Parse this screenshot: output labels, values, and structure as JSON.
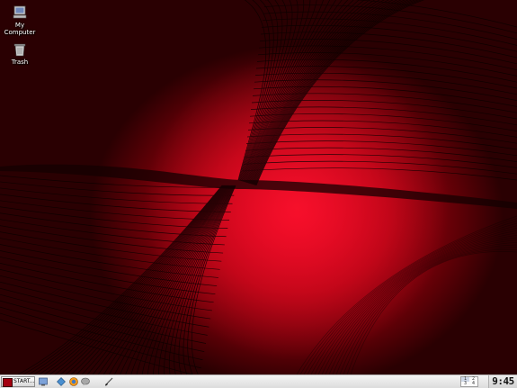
{
  "desktop": {
    "icons": [
      {
        "label_line1": "My",
        "label_line2": "Computer",
        "icon": "computer-icon"
      },
      {
        "label": "Trash",
        "icon": "trash-icon"
      }
    ]
  },
  "taskbar": {
    "start_label": "START...",
    "quick_launch": [
      {
        "icon": "show-desktop-icon"
      },
      {
        "icon": "network-icon"
      },
      {
        "icon": "browser-icon"
      },
      {
        "icon": "chat-icon"
      },
      {
        "icon": "brush-icon"
      }
    ],
    "pager": {
      "desktops": [
        "1",
        "2",
        "3",
        "4"
      ],
      "active": "1"
    },
    "clock": "9:45"
  },
  "colors": {
    "wallpaper_accent": "#d4001a",
    "wallpaper_dark": "#1a0001",
    "taskbar_bg": "#e4e4e4"
  }
}
